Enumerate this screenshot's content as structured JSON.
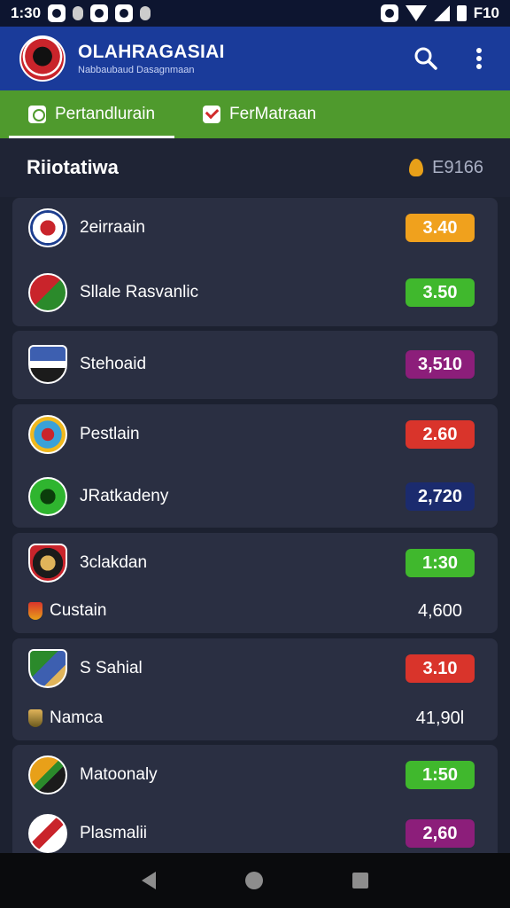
{
  "status_bar": {
    "time": "1:30",
    "right_text": "F10"
  },
  "app_bar": {
    "title": "OLAHRAGASIAI",
    "subtitle": "Nabbaubaud Dasagnmaan",
    "icons": [
      "search-icon",
      "more-vert-icon"
    ]
  },
  "tabs": [
    {
      "label": "Pertandlurain",
      "icon": "match-icon",
      "active": true
    },
    {
      "label": "FerMatraan",
      "icon": "check-box-icon",
      "active": false
    }
  ],
  "section": {
    "title": "Riiotatiwa",
    "meta": "E9166",
    "meta_icon": "flame-icon"
  },
  "cards": [
    {
      "rows": [
        {
          "team": "2eirraain",
          "odd": "3.40",
          "odd_color": "#f0a11d"
        },
        {
          "team": "Sllale Rasvanlic",
          "odd": "3.50",
          "odd_color": "#40b82d"
        }
      ]
    },
    {
      "rows": [
        {
          "team": "Stehoaid",
          "odd": "3,510",
          "odd_color": "#8c1e7a"
        }
      ]
    },
    {
      "rows": [
        {
          "team": "Pestlain",
          "odd": "2.60",
          "odd_color": "#d9342b"
        },
        {
          "team": "JRatkadeny",
          "odd": "2,720",
          "odd_color": "#1b2b6e"
        }
      ]
    },
    {
      "rows": [
        {
          "team": "3clakdan",
          "odd": "1:30",
          "odd_color": "#40b82d"
        }
      ],
      "extra": {
        "label": "Custain",
        "value": "4,600"
      }
    },
    {
      "rows": [
        {
          "team": "S Sahial",
          "odd": "3.10",
          "odd_color": "#d9342b"
        }
      ],
      "extra": {
        "label": "Namca",
        "value": "41,90l"
      }
    },
    {
      "rows": [
        {
          "team": "Matoonaly",
          "odd": "1:50",
          "odd_color": "#40b82d"
        },
        {
          "team": "Plasmalii",
          "odd": "2,60",
          "odd_color": "#8c1e7a"
        }
      ]
    }
  ],
  "nav_bar": {
    "icons": [
      "back-icon",
      "home-icon",
      "recents-icon"
    ]
  }
}
